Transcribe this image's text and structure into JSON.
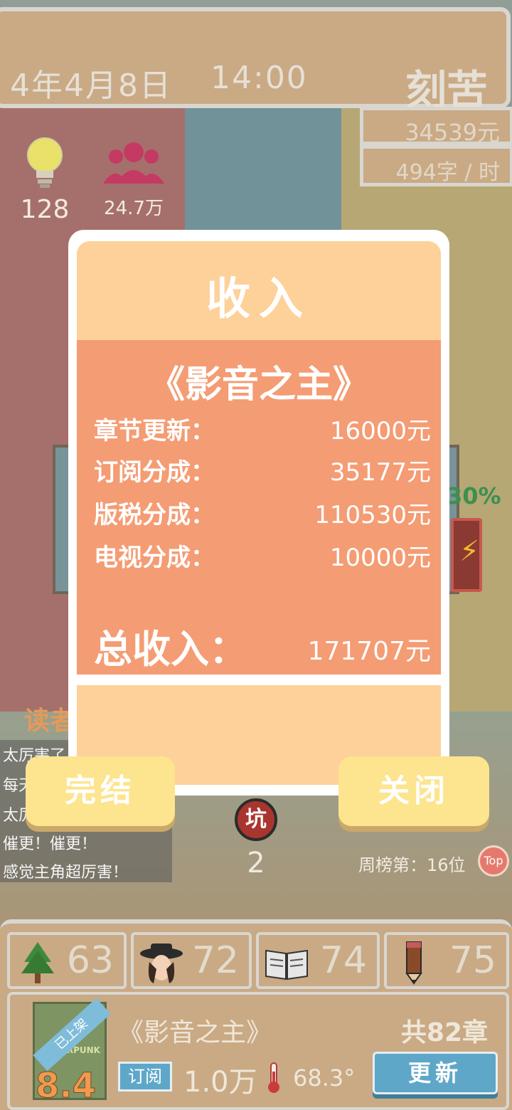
{
  "header": {
    "date": "4年4月8日",
    "time": "14:00",
    "mood": "刻苦",
    "money": "34539元",
    "speed": "494字 / 时"
  },
  "stats": {
    "ideas": "128",
    "fans": "24.7万"
  },
  "modal": {
    "title": "收入",
    "book_title": "《影音之主》",
    "rows": [
      {
        "label": "章节更新：",
        "amount": "16000元"
      },
      {
        "label": "订阅分成：",
        "amount": "35177元"
      },
      {
        "label": "版税分成：",
        "amount": "110530元"
      },
      {
        "label": "电视分成：",
        "amount": "10000元"
      }
    ],
    "total_label": "总收入：",
    "total_amount": "171707元"
  },
  "buttons": {
    "finish": "完结",
    "close": "关闭"
  },
  "middle": {
    "reader_label": "读者",
    "pit_icon_label": "坑",
    "pit_count": "2",
    "rank": "周榜第：16位",
    "top_badge": "Top",
    "energy_percent": "30%",
    "comments": [
      "太厉害了",
      "每天",
      "太厉害",
      "催更！催更！",
      "感觉主角超厉害！"
    ]
  },
  "attributes": [
    {
      "icon": "tree-icon",
      "value": "63"
    },
    {
      "icon": "detective-icon",
      "value": "72"
    },
    {
      "icon": "book-icon",
      "value": "74"
    },
    {
      "icon": "pencil-icon",
      "value": "75"
    }
  ],
  "book_card": {
    "shelf_status": "已上架",
    "cover_text": "CYBERPUNK",
    "score": "8.4",
    "title": "《影音之主》",
    "chapters": "共82章",
    "sub_label": "订阅",
    "sub_count": "1.0万",
    "heat": "68.3°",
    "update_label": "更新"
  },
  "colors": {
    "panel": "#c9aa85",
    "modal_head": "#fdd199",
    "modal_body": "#f49c74",
    "button": "#fde48f",
    "update_button": "#5fa7c8"
  }
}
